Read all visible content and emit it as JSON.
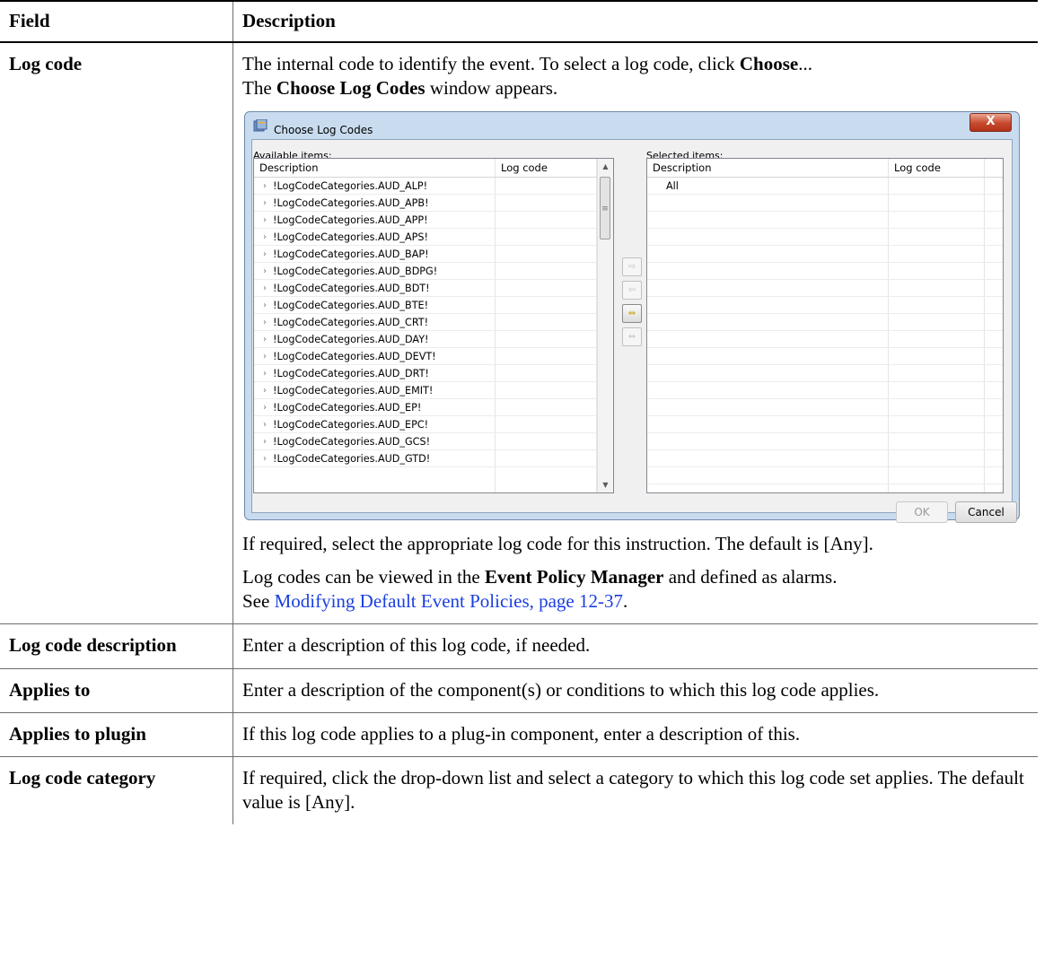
{
  "table": {
    "header_field": "Field",
    "header_description": "Description",
    "rows": {
      "log_code": {
        "field": "Log code",
        "intro_1": "The internal code to identify the event. To select a log code, click ",
        "intro_choose": "Choose",
        "intro_2": "...",
        "intro_3": "The ",
        "intro_window": "Choose Log Codes",
        "intro_4": " window appears.",
        "after_1": "If required, select the appropriate log code for this instruction. The default is [Any].",
        "after_2a": "Log codes can be viewed in the ",
        "after_2b": "Event Policy Manager",
        "after_2c": " and defined as alarms.",
        "after_3a": "See ",
        "after_3_link": "Modifying Default Event Policies, page 12-37",
        "after_3b": "."
      },
      "log_code_description": {
        "field": "Log code description",
        "desc": "Enter a description of this log code, if needed."
      },
      "applies_to": {
        "field": "Applies to",
        "desc": "Enter a description of the component(s) or conditions to which this log code applies."
      },
      "applies_to_plugin": {
        "field": "Applies to plugin",
        "desc": "If this log code applies to a plug-in component, enter a description of this."
      },
      "log_code_category": {
        "field": "Log code category",
        "desc": "If required, click the drop-down list and select a category to which this log code set applies. The default value is [Any]."
      }
    }
  },
  "dialog": {
    "title": "Choose Log Codes",
    "close_label": "X",
    "available_label": "Available items:",
    "selected_label": "Selected items:",
    "col_description": "Description",
    "col_log_code": "Log code",
    "available_items": [
      "!LogCodeCategories.AUD_ALP!",
      "!LogCodeCategories.AUD_APB!",
      "!LogCodeCategories.AUD_APP!",
      "!LogCodeCategories.AUD_APS!",
      "!LogCodeCategories.AUD_BAP!",
      "!LogCodeCategories.AUD_BDPG!",
      "!LogCodeCategories.AUD_BDT!",
      "!LogCodeCategories.AUD_BTE!",
      "!LogCodeCategories.AUD_CRT!",
      "!LogCodeCategories.AUD_DAY!",
      "!LogCodeCategories.AUD_DEVT!",
      "!LogCodeCategories.AUD_DRT!",
      "!LogCodeCategories.AUD_EMIT!",
      "!LogCodeCategories.AUD_EP!",
      "!LogCodeCategories.AUD_EPC!",
      "!LogCodeCategories.AUD_GCS!",
      "!LogCodeCategories.AUD_GTD!"
    ],
    "selected_items": [
      "All"
    ],
    "ok_label": "OK",
    "cancel_label": "Cancel"
  }
}
